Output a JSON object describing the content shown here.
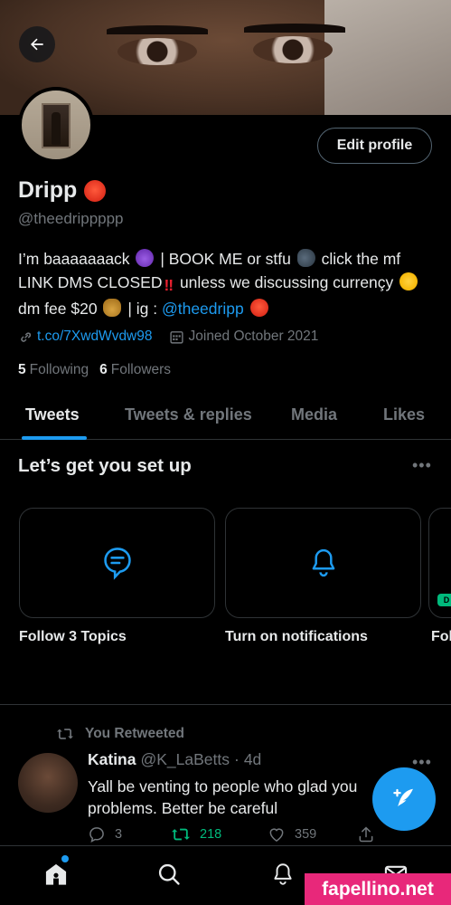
{
  "header": {
    "back_label": "Back"
  },
  "profile": {
    "edit_button": "Edit profile",
    "display_name": "Dripp",
    "handle": "@theedrippppp",
    "bio": {
      "part1": "I’m baaaaaaack",
      "part2": "| BOOK ME or stfu",
      "part3": "click the mf LINK DMS CLOSED",
      "part4": "unless we discussing currençy",
      "part5": "dm fee $20",
      "part6": "| ig :",
      "ig_mention": "@theedripp"
    },
    "link": "t.co/7XwdWvdw98",
    "joined": "Joined October 2021",
    "following_count": "5",
    "following_label": "Following",
    "followers_count": "6",
    "followers_label": "Followers"
  },
  "tabs": [
    {
      "label": "Tweets",
      "active": true
    },
    {
      "label": "Tweets & replies",
      "active": false
    },
    {
      "label": "Media",
      "active": false
    },
    {
      "label": "Likes",
      "active": false
    }
  ],
  "setup": {
    "title": "Let’s get you set up",
    "more": "•••",
    "cards": [
      {
        "label": "Follow 3 Topics",
        "icon": "topics-icon"
      },
      {
        "label": "Turn on notifications",
        "icon": "bell-icon"
      },
      {
        "label": "Fol",
        "icon": "partial-card"
      }
    ],
    "partial_badge": "D"
  },
  "tweet": {
    "retweet_label": "You Retweeted",
    "author_name": "Katina",
    "author_handle": "@K_LaBetts",
    "separator": "·",
    "time": "4d",
    "text_line1": "Yall be venting to people who glad you",
    "text_line2": "problems. Better be careful",
    "replies": "3",
    "retweets": "218",
    "likes": "359",
    "more": "•••"
  },
  "bottom_nav": [
    "home-icon",
    "search-icon",
    "notifications-icon",
    "messages-icon"
  ],
  "watermark": "fapellino.net",
  "colors": {
    "accent": "#1d9bf0",
    "retweet_green": "#00ba7c",
    "muted": "#71767b",
    "text": "#e7e9ea",
    "background": "#000000",
    "watermark_bg": "#e8287a"
  }
}
